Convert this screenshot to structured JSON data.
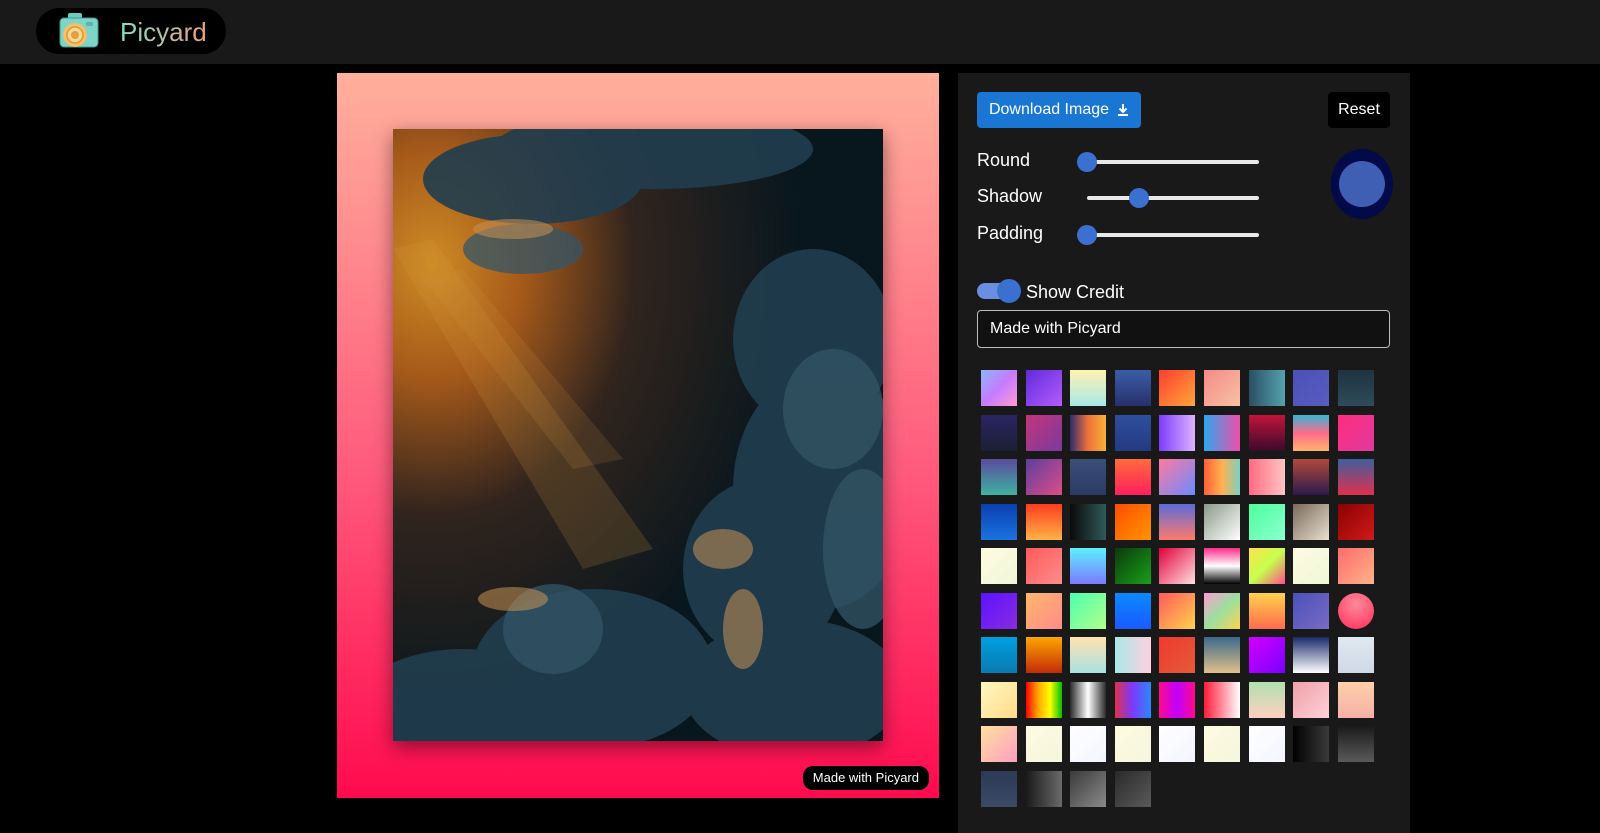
{
  "brand": {
    "name": "Picyard",
    "logo_icon": "camera-icon"
  },
  "editor": {
    "credit_badge": "Made with Picyard",
    "background": [
      "#ffb09c",
      "#ff5a7c",
      "#ff0a4e"
    ]
  },
  "panel": {
    "download_label": "Download Image",
    "download_icon": "download-icon",
    "reset_label": "Reset",
    "sliders": [
      {
        "label": "Round",
        "value": 0
      },
      {
        "label": "Shadow",
        "value": 0.3
      },
      {
        "label": "Padding",
        "value": 0
      }
    ],
    "accent_color": "#3f5fb5",
    "show_credit_label": "Show Credit",
    "show_credit_on": true,
    "credit_text": "Made with Picyard"
  },
  "swatches": [
    "linear-gradient(135deg,#8fb5ff,#c57bff,#ff9bd1)",
    "linear-gradient(135deg,#5f2bd9,#b45cff)",
    "linear-gradient(180deg,#fff3b0,#a8e8e8)",
    "linear-gradient(180deg,#3a5da8,#28306b)",
    "linear-gradient(135deg,#ff3d2e,#ffa63a)",
    "linear-gradient(135deg,#f58a8a,#f7c2a2)",
    "linear-gradient(90deg,#2a4f63,#56a2b0)",
    "linear-gradient(135deg,#4b51b8,#585cbe)",
    "linear-gradient(180deg,#1f3340,#2e4b59)",
    "linear-gradient(180deg,#2b2462,#1b2035)",
    "linear-gradient(135deg,#c2357a,#7c3a9e)",
    "linear-gradient(90deg,#2d2c6e,#f0713a,#f5b338)",
    "linear-gradient(180deg,#2e4f9c,#243a82)",
    "linear-gradient(90deg,#7a3dff,#e0b3ff)",
    "linear-gradient(90deg,#2ca6f0,#f04ea8)",
    "linear-gradient(180deg,#c2143c,#3b0a2a)",
    "linear-gradient(180deg,#35b6d6,#ff6b8b,#ffb36b)",
    "linear-gradient(135deg,#ff2d7a,#e03aa0)",
    "linear-gradient(180deg,#5b4a9e,#3fb3a0)",
    "linear-gradient(135deg,#5b3e9e,#e04d87)",
    "linear-gradient(180deg,#3b4f7a,#2b3b63)",
    "linear-gradient(180deg,#ff6b3a,#ff1f5e)",
    "linear-gradient(135deg,#ff7a9f,#6a8aff)",
    "linear-gradient(90deg,#ff5e3a,#ffb14e,#7ed0c0)",
    "linear-gradient(90deg,#ff6b81,#ffc4c4)",
    "linear-gradient(180deg,#b04a3a,#2d1a4e)",
    "linear-gradient(180deg,#3f5e9e,#e0304e)",
    "linear-gradient(180deg,#0a3fb0,#1a73e0)",
    "linear-gradient(180deg,#ff3d1f,#ffb347)",
    "linear-gradient(90deg,#0a0a0a,#2f5a58)",
    "linear-gradient(135deg,#ff4d00,#ff9500)",
    "linear-gradient(180deg,#5b6bd9,#ff7a6b)",
    "linear-gradient(135deg,#8a9a8a,#ffffff)",
    "linear-gradient(135deg,#4dff9c,#8affd0)",
    "linear-gradient(135deg,#7a6a5a,#e8e0d0)",
    "linear-gradient(135deg,#8a0000,#d01a1a)",
    "linear-gradient(135deg,#fffbe0,#f0f7d8)",
    "linear-gradient(135deg,#ff5a5a,#ff8c8c)",
    "linear-gradient(180deg,#5ef0ff,#7a7aff)",
    "linear-gradient(135deg,#0a3a0a,#1aa01a)",
    "linear-gradient(135deg,#e0003a,#ffe0e0)",
    "linear-gradient(180deg,#ff2d8a,#ffffff 50%,#000000)",
    "linear-gradient(135deg,#ffe14d,#c6ff4d,#ff4d8a)",
    "linear-gradient(135deg,#fffbe0,#eef7d8)",
    "linear-gradient(135deg,#ff6b6b,#ffb38a)",
    "linear-gradient(135deg,#5b12ff,#8a2be2)",
    "linear-gradient(135deg,#ffb86b,#ff8a8a)",
    "linear-gradient(135deg,#4dffb0,#b0ff8a)",
    "linear-gradient(180deg,#0a8aff,#1a5aff)",
    "linear-gradient(135deg,#ff5a5a,#ffd24d)",
    "linear-gradient(135deg,#ff9bd1,#9be0a0,#ffd24d)",
    "linear-gradient(180deg,#ffd24d,#ff6b4d)",
    "linear-gradient(135deg,#4b51b8,#7a6bc7)",
    "radial-gradient(circle at 50% 30%,#ff8a9a,#ff2d5a)",
    "linear-gradient(180deg,#00a0e0,#0a7ab0)",
    "linear-gradient(180deg,#ffa600,#c22a0a)",
    "linear-gradient(180deg,#ffe3b0,#a8e0e0)",
    "linear-gradient(90deg,#a8e8e8,#ffd0e0)",
    "linear-gradient(135deg,#f03a2e,#e55a3a)",
    "linear-gradient(180deg,#3a6a8a,#e0c08a)",
    "linear-gradient(135deg,#d200ff,#7a00ff)",
    "linear-gradient(180deg,#1a2a6a,#ffffff)",
    "linear-gradient(180deg,#e0e8f0,#cfd9e6)",
    "linear-gradient(135deg,#fff9c0,#ffd98a)",
    "linear-gradient(90deg,#ff0000,#ffa500,#ffff00,#00c000)",
    "linear-gradient(90deg,#2a2a2a,#ffffff,#2a2a2a)",
    "linear-gradient(90deg,#e0304e,#7a3aff,#2a8aff)",
    "linear-gradient(90deg,#ff0a8a,#c000ff,#ff0a8a)",
    "linear-gradient(90deg,#ff1a3a,#ffffff)",
    "linear-gradient(180deg,#b0e0b0,#ffd0c0)",
    "linear-gradient(135deg,#f0a0a8,#ffd0d8)",
    "linear-gradient(180deg,#ffd0a8,#f6b0a8)",
    "linear-gradient(135deg,#ffe0a0,#ff9ec0)",
    "linear-gradient(135deg,#fffbe0,#f3f6de)",
    "linear-gradient(135deg,#ffffff,#f3f5ff)",
    "linear-gradient(135deg,#fffbe0,#f3f6de)",
    "linear-gradient(135deg,#ffffff,#f3f5ff)",
    "linear-gradient(135deg,#fffbe0,#f3f6de)",
    "linear-gradient(135deg,#ffffff,#f3f5ff)",
    "linear-gradient(90deg,#000000,#3a3a3a)",
    "linear-gradient(180deg,#1a1a1a,#5a5a5a)",
    "linear-gradient(180deg,#2b3a55,#3b4a66)",
    "linear-gradient(90deg,#1a1a1a,#6a6a6a)",
    "linear-gradient(135deg,#3a3a3a,#8a8a8a)",
    "linear-gradient(135deg,#2a2a2a,#5a5a5a)"
  ]
}
